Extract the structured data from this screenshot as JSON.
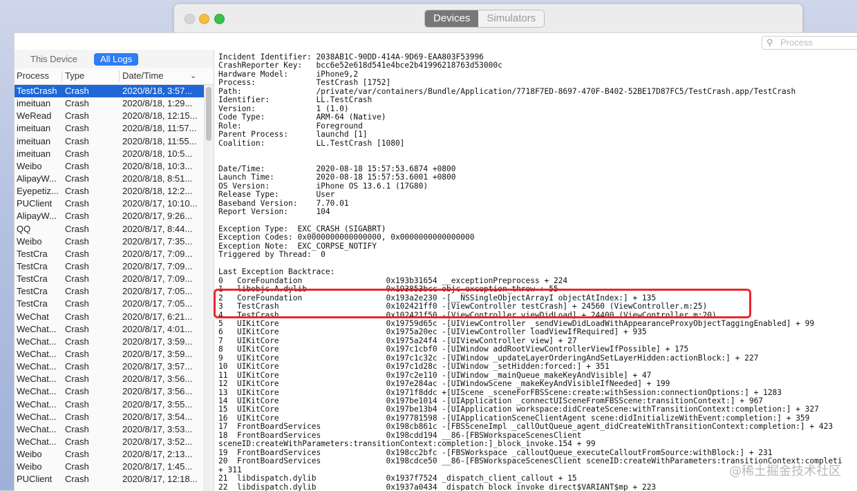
{
  "devices_window": {
    "tabs": [
      {
        "label": "Devices",
        "active": true
      },
      {
        "label": "Simulators",
        "active": false
      }
    ]
  },
  "search": {
    "placeholder": "Process",
    "icon": "search-icon"
  },
  "sidebar": {
    "tabs": [
      {
        "label": "This Device",
        "active": false
      },
      {
        "label": "All Logs",
        "active": true
      }
    ],
    "columns": [
      "Process",
      "Type",
      "Date/Time"
    ],
    "rows": [
      {
        "process": "TestCrash",
        "type": "Crash",
        "date": "2020/8/18, 3:57..."
      },
      {
        "process": "imeituan",
        "type": "Crash",
        "date": "2020/8/18, 1:29..."
      },
      {
        "process": "WeRead",
        "type": "Crash",
        "date": "2020/8/18, 12:15..."
      },
      {
        "process": "imeituan",
        "type": "Crash",
        "date": "2020/8/18, 11:57..."
      },
      {
        "process": "imeituan",
        "type": "Crash",
        "date": "2020/8/18, 11:55..."
      },
      {
        "process": "imeituan",
        "type": "Crash",
        "date": "2020/8/18, 10:5..."
      },
      {
        "process": "Weibo",
        "type": "Crash",
        "date": "2020/8/18, 10:3..."
      },
      {
        "process": "AlipayW...",
        "type": "Crash",
        "date": "2020/8/18, 8:51..."
      },
      {
        "process": "Eyepetiz...",
        "type": "Crash",
        "date": "2020/8/18, 12:2..."
      },
      {
        "process": "PUClient",
        "type": "Crash",
        "date": "2020/8/17, 10:10..."
      },
      {
        "process": "AlipayW...",
        "type": "Crash",
        "date": "2020/8/17, 9:26..."
      },
      {
        "process": "QQ",
        "type": "Crash",
        "date": "2020/8/17, 8:44..."
      },
      {
        "process": "Weibo",
        "type": "Crash",
        "date": "2020/8/17, 7:35..."
      },
      {
        "process": "TestCra",
        "type": "Crash",
        "date": "2020/8/17, 7:09..."
      },
      {
        "process": "TestCra",
        "type": "Crash",
        "date": "2020/8/17, 7:09..."
      },
      {
        "process": "TestCra",
        "type": "Crash",
        "date": "2020/8/17, 7:09..."
      },
      {
        "process": "TestCra",
        "type": "Crash",
        "date": "2020/8/17, 7:05..."
      },
      {
        "process": "TestCra",
        "type": "Crash",
        "date": "2020/8/17, 7:05..."
      },
      {
        "process": "WeChat",
        "type": "Crash",
        "date": "2020/8/17, 6:21..."
      },
      {
        "process": "WeChat...",
        "type": "Crash",
        "date": "2020/8/17, 4:01..."
      },
      {
        "process": "WeChat...",
        "type": "Crash",
        "date": "2020/8/17, 3:59..."
      },
      {
        "process": "WeChat...",
        "type": "Crash",
        "date": "2020/8/17, 3:59..."
      },
      {
        "process": "WeChat...",
        "type": "Crash",
        "date": "2020/8/17, 3:57..."
      },
      {
        "process": "WeChat...",
        "type": "Crash",
        "date": "2020/8/17, 3:56..."
      },
      {
        "process": "WeChat...",
        "type": "Crash",
        "date": "2020/8/17, 3:56..."
      },
      {
        "process": "WeChat...",
        "type": "Crash",
        "date": "2020/8/17, 3:55..."
      },
      {
        "process": "WeChat...",
        "type": "Crash",
        "date": "2020/8/17, 3:54..."
      },
      {
        "process": "WeChat...",
        "type": "Crash",
        "date": "2020/8/17, 3:53..."
      },
      {
        "process": "WeChat...",
        "type": "Crash",
        "date": "2020/8/17, 3:52..."
      },
      {
        "process": "Weibo",
        "type": "Crash",
        "date": "2020/8/17, 2:13..."
      },
      {
        "process": "Weibo",
        "type": "Crash",
        "date": "2020/8/17, 1:45..."
      },
      {
        "process": "PUClient",
        "type": "Crash",
        "date": "2020/8/17, 12:18..."
      }
    ]
  },
  "log_lines": [
    "Incident Identifier: 2038AB1C-90DD-414A-9D69-EAA803F53996",
    "CrashReporter Key:   bcc6e52e618d541e4bce2b41996218763d53000c",
    "Hardware Model:      iPhone9,2",
    "Process:             TestCrash [1752]",
    "Path:                /private/var/containers/Bundle/Application/7718F7ED-8697-470F-B402-52BE17D87FC5/TestCrash.app/TestCrash",
    "Identifier:          LL.TestCrash",
    "Version:             1 (1.0)",
    "Code Type:           ARM-64 (Native)",
    "Role:                Foreground",
    "Parent Process:      launchd [1]",
    "Coalition:           LL.TestCrash [1080]",
    "",
    "",
    "Date/Time:           2020-08-18 15:57:53.6874 +0800",
    "Launch Time:         2020-08-18 15:57:53.6001 +0800",
    "OS Version:          iPhone OS 13.6.1 (17G80)",
    "Release Type:        User",
    "Baseband Version:    7.70.01",
    "Report Version:      104",
    "",
    "Exception Type:  EXC_CRASH (SIGABRT)",
    "Exception Codes: 0x0000000000000000, 0x0000000000000000",
    "Exception Note:  EXC_CORPSE_NOTIFY",
    "Triggered by Thread:  0",
    "",
    "Last Exception Backtrace:",
    "0   CoreFoundation                  0x193b31654 __exceptionPreprocess + 224",
    "1   libobjc.A.dylib                 0x193853bcc objc_exception_throw + 55",
    "2   CoreFoundation                  0x193a2e230 -[__NSSingleObjectArrayI objectAtIndex:] + 135",
    "3   TestCrash                       0x102421ff0 -[ViewController testCrash] + 24560 (ViewController.m:25)",
    "4   TestCrash                       0x102421f50 -[ViewController viewDidLoad] + 24400 (ViewController.m:20)",
    "5   UIKitCore                       0x19759d65c -[UIViewController _sendViewDidLoadWithAppearanceProxyObjectTaggingEnabled] + 99",
    "6   UIKitCore                       0x1975a20ec -[UIViewController loadViewIfRequired] + 935",
    "7   UIKitCore                       0x1975a24f4 -[UIViewController view] + 27",
    "8   UIKitCore                       0x197c1cbf0 -[UIWindow addRootViewControllerViewIfPossible] + 175",
    "9   UIKitCore                       0x197c1c32c -[UIWindow _updateLayerOrderingAndSetLayerHidden:actionBlock:] + 227",
    "10  UIKitCore                       0x197c1d28c -[UIWindow _setHidden:forced:] + 351",
    "11  UIKitCore                       0x197c2e110 -[UIWindow _mainQueue_makeKeyAndVisible] + 47",
    "12  UIKitCore                       0x197e284ac -[UIWindowScene _makeKeyAndVisibleIfNeeded] + 199",
    "13  UIKitCore                       0x1971f8ddc +[UIScene _sceneForFBSScene:create:withSession:connectionOptions:] + 1283",
    "14  UIKitCore                       0x197be1014 -[UIApplication _connectUISceneFromFBSScene:transitionContext:] + 967",
    "15  UIKitCore                       0x197be13b4 -[UIApplication workspace:didCreateScene:withTransitionContext:completion:] + 327",
    "16  UIKitCore                       0x197781598 -[UIApplicationSceneClientAgent scene:didInitializeWithEvent:completion:] + 359",
    "17  FrontBoardServices              0x198cb861c -[FBSSceneImpl _callOutQueue_agent_didCreateWithTransitionContext:completion:] + 423",
    "18  FrontBoardServices              0x198cdd194 __86-[FBSWorkspaceScenesClient",
    "sceneID:createWithParameters:transitionContext:completion:]_block_invoke.154 + 99",
    "19  FrontBoardServices              0x198cc2bfc -[FBSWorkspace _calloutQueue_executeCalloutFromSource:withBlock:] + 231",
    "20  FrontBoardServices              0x198cdce50 __86-[FBSWorkspaceScenesClient sceneID:createWithParameters:transitionContext:completi",
    "+ 311",
    "21  libdispatch.dylib               0x1937f7524 _dispatch_client_callout + 15",
    "22  libdispatch.dylib               0x1937a0434 _dispatch_block_invoke_direct$VARIANT$mp + 223"
  ],
  "watermark": "@稀土掘金技术社区",
  "colors": {
    "accent": "#2e7cf6",
    "selection": "#1f67d6",
    "highlight_box": "#e8262c"
  }
}
